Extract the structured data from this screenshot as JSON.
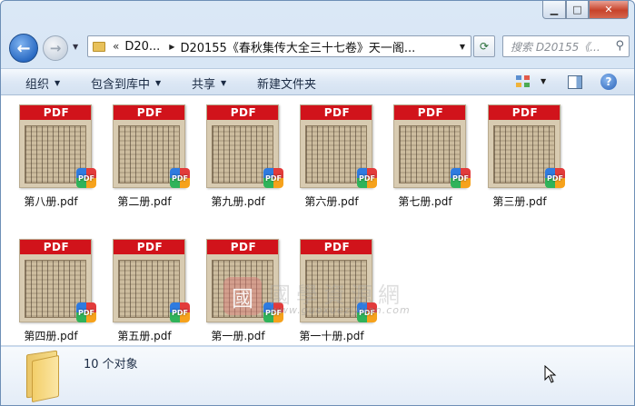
{
  "navbar": {
    "history_glyph": "▼",
    "address_chevron": "«",
    "breadcrumb": [
      "D20...",
      "D20155《春秋集传大全三十七卷》天一阁..."
    ],
    "refresh_glyph": "⟳",
    "search_placeholder": "搜索 D20155《..."
  },
  "commandbar": {
    "organize": "组织",
    "include_in_library": "包含到库中",
    "share": "共享",
    "new_folder": "新建文件夹"
  },
  "file_badge_text": "PDF",
  "files": [
    {
      "name": "第八册.pdf"
    },
    {
      "name": "第二册.pdf"
    },
    {
      "name": "第九册.pdf"
    },
    {
      "name": "第六册.pdf"
    },
    {
      "name": "第七册.pdf"
    },
    {
      "name": "第三册.pdf"
    },
    {
      "name": "第四册.pdf"
    },
    {
      "name": "第五册.pdf"
    },
    {
      "name": "第一册.pdf"
    },
    {
      "name": "第一十册.pdf"
    }
  ],
  "watermark": {
    "seal": "國",
    "text": "國學資源網",
    "url": "www.guoxueziyuan.com"
  },
  "details": {
    "item_count": "10 个对象"
  },
  "icons": [
    "back-icon",
    "forward-icon",
    "folder-icon",
    "refresh-icon",
    "search-icon",
    "view-icon",
    "preview-pane-icon",
    "help-icon",
    "pdf-icon"
  ]
}
